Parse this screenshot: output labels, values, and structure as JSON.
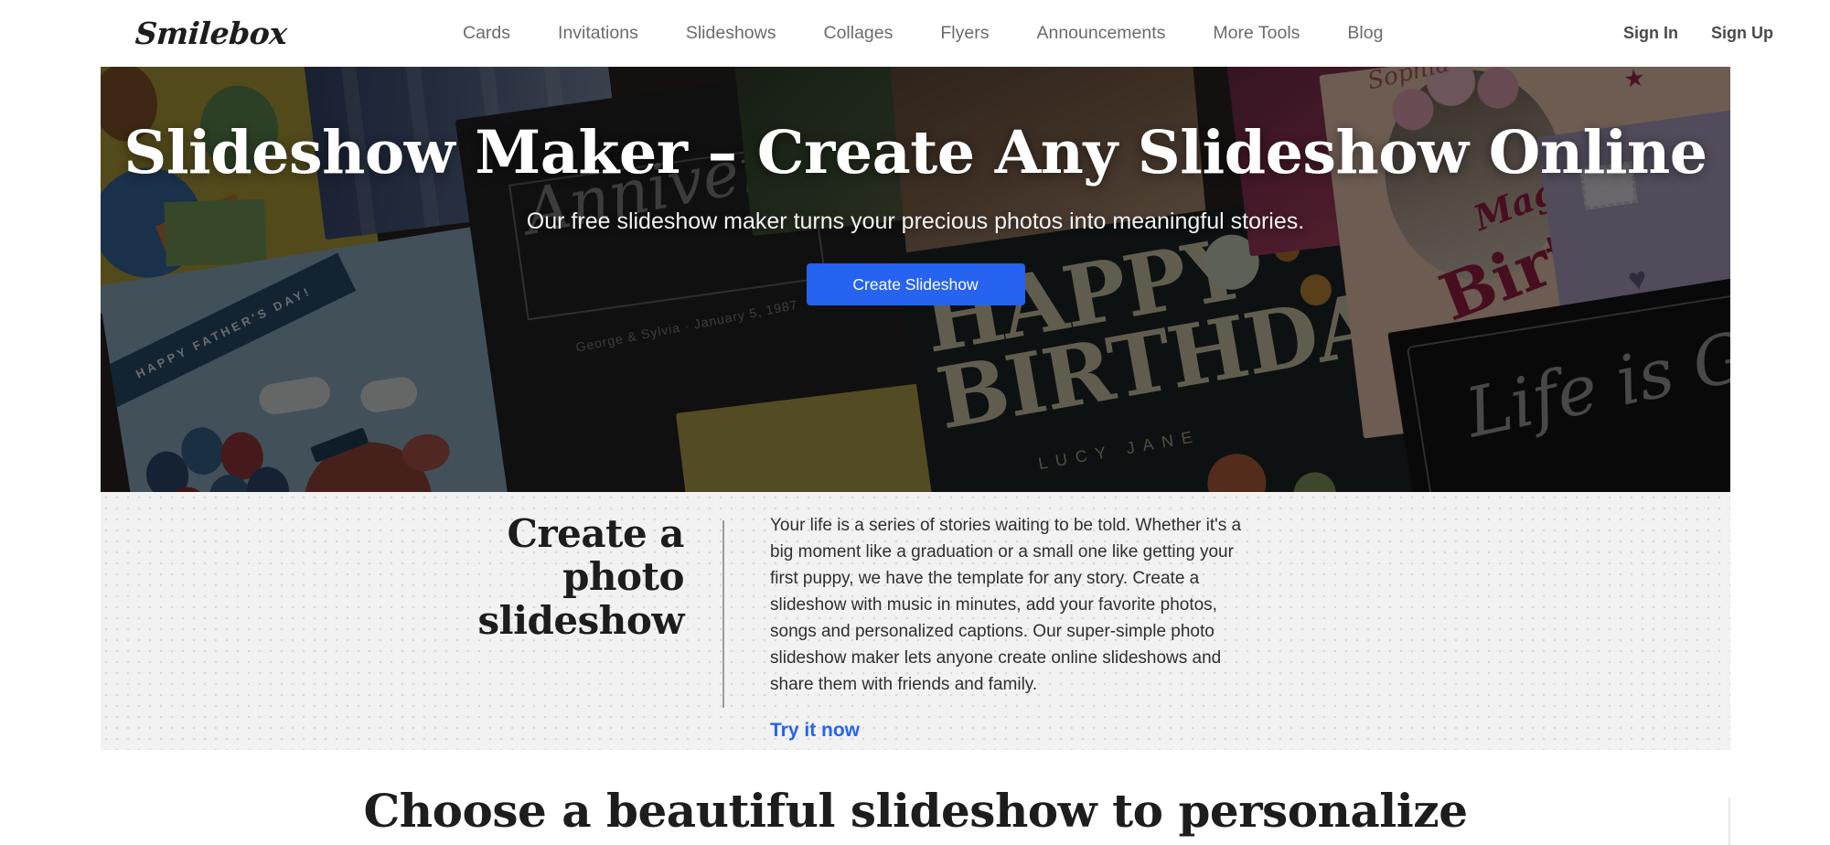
{
  "nav": {
    "logo_text": "Smilebox",
    "links": [
      {
        "label": "Cards"
      },
      {
        "label": "Invitations"
      },
      {
        "label": "Slideshows"
      },
      {
        "label": "Collages"
      },
      {
        "label": "Flyers"
      },
      {
        "label": "Announcements"
      },
      {
        "label": "More Tools"
      },
      {
        "label": "Blog"
      }
    ],
    "sign_in": "Sign In",
    "sign_up": "Sign Up"
  },
  "hero": {
    "title": "Slideshow Maker – Create Any Slideshow Online",
    "subtitle": "Our free slideshow maker turns your precious photos into meaningful stories.",
    "cta_label": "Create Slideshow",
    "cta_color": "#2563f0",
    "overlay_color": "rgba(0,0,0,0.55)",
    "card_art": {
      "fathers_day_banner": "HAPPY FATHER'S DAY!",
      "anniversary_script": "Anniversary",
      "anniversary_sub": "George & Sylvia · January 5, 1987",
      "birthday_line1": "HAPPY",
      "birthday_line2": "BIRTHDAY",
      "birthday_name": "LUCY JANE",
      "magical_name": "Sophia",
      "magical_word1": "Magical",
      "magical_word2": "Birthday",
      "life_is_good": "Life is GOOD"
    }
  },
  "promo": {
    "heading": "Create a photo slideshow",
    "body": "Your life is a series of stories waiting to be told. Whether it's a big moment like a graduation or a small one like getting your first puppy, we have the template for any story. Create a slideshow with music in minutes, add your favorite photos, songs and personalized captions. Our super-simple photo slideshow maker lets anyone create online slideshows and share them with friends and family.",
    "link_label": "Try it now",
    "link_color": "#2563f0",
    "background_color": "#f2f2f2",
    "dot_color": "#d9d9d9"
  },
  "bottom": {
    "heading": "Choose a beautiful slideshow to personalize"
  }
}
